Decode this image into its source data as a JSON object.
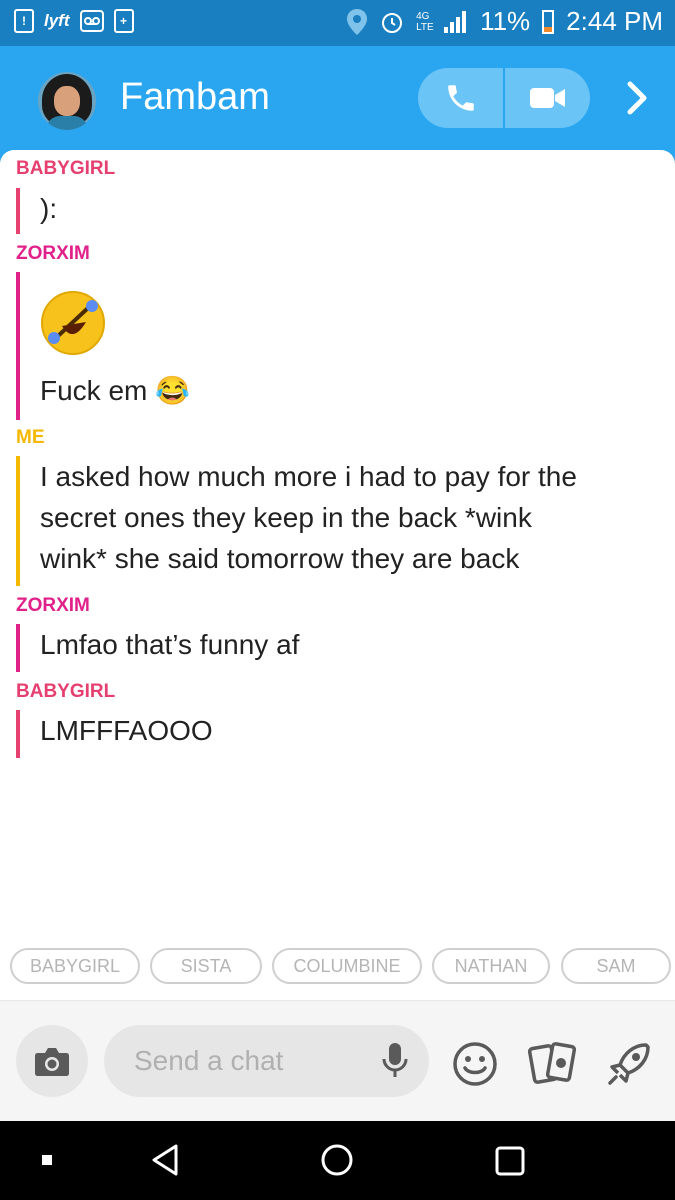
{
  "status_bar": {
    "carrier_app": "lyft",
    "signal_label": "4G LTE",
    "battery": "11%",
    "time": "2:44 PM"
  },
  "header": {
    "title": "Fambam"
  },
  "messages": [
    {
      "sender": "BABYGIRL",
      "sender_color": "#e5406f",
      "lines": [
        "):"
      ]
    },
    {
      "sender": "ZORXIM",
      "sender_color": "#e0218a",
      "lines": [
        "🤣",
        "Fuck em 😂"
      ]
    },
    {
      "sender": "ME",
      "sender_color": "#f5b800",
      "lines": [
        "I asked how much more i had to pay for the",
        "secret ones they keep in the back *wink",
        "wink* she said tomorrow they are back"
      ]
    },
    {
      "sender": "ZORXIM",
      "sender_color": "#e0218a",
      "lines": [
        "Lmfao that’s funny af"
      ]
    },
    {
      "sender": "BABYGIRL",
      "sender_color": "#e5406f",
      "lines": [
        "LMFFFAOOO"
      ]
    }
  ],
  "participants": [
    "BABYGIRL",
    "SISTA",
    "COLUMBINE",
    "NATHAN",
    "SAM"
  ],
  "composer": {
    "placeholder": "Send a chat"
  },
  "icons": [
    "camera-icon",
    "mic-icon",
    "smiley-icon",
    "cards-icon",
    "rocket-icon",
    "phone-icon",
    "video-icon",
    "chevron-right-icon"
  ],
  "colors": {
    "header_bg": "#2aa6f0",
    "statusbar_bg": "#1a7fc0",
    "me_color": "#f5b800",
    "babygirl_color": "#e5406f",
    "zorxim_color": "#e0218a"
  }
}
